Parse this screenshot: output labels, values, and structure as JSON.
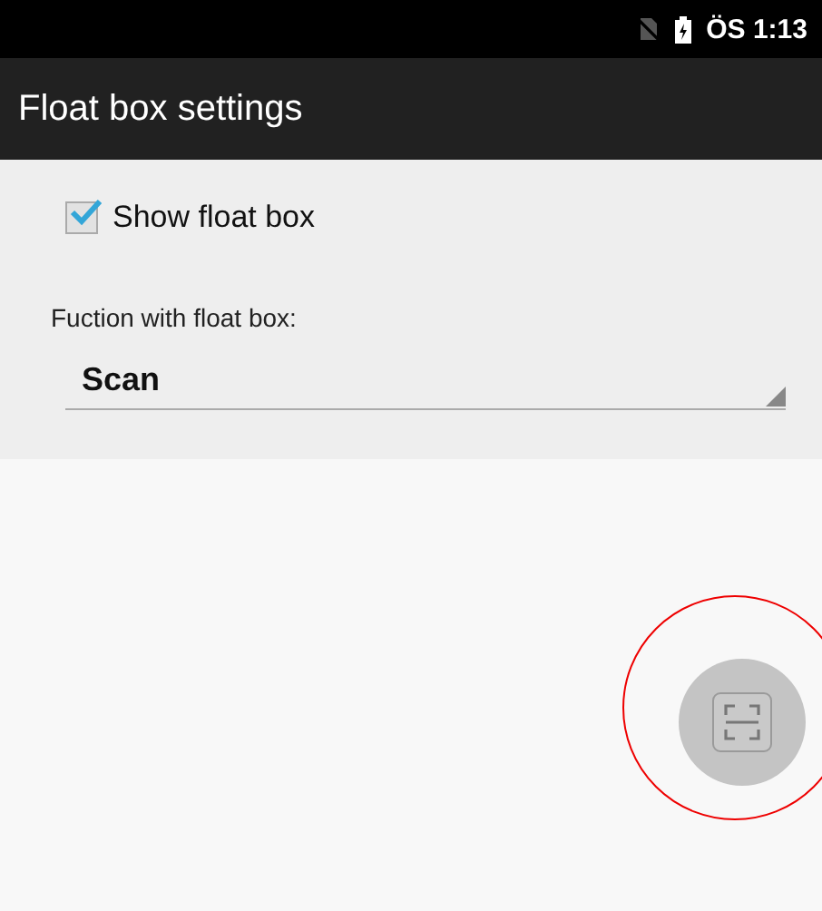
{
  "status_bar": {
    "time": "ÖS 1:13"
  },
  "app_bar": {
    "title": "Float box settings"
  },
  "settings": {
    "show_float_box": {
      "label": "Show float box",
      "checked": true
    },
    "function": {
      "label": "Fuction with float box:",
      "value": "Scan"
    }
  },
  "float_box": {
    "highlighted": true
  }
}
